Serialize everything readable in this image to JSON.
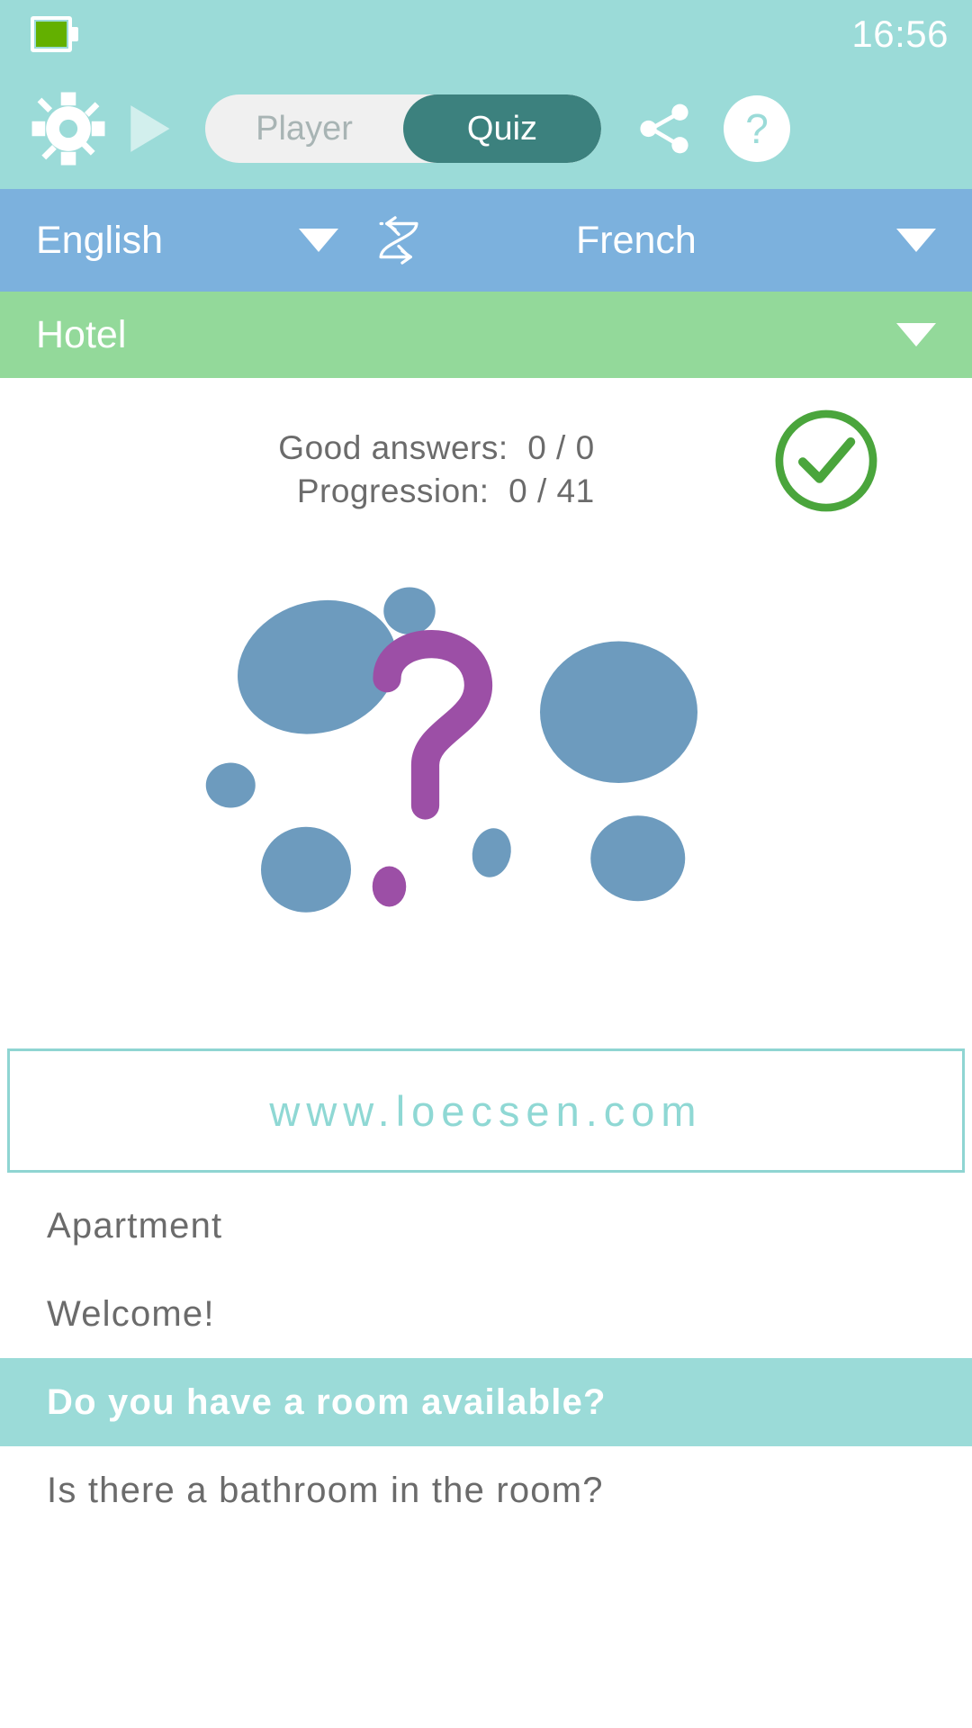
{
  "statusbar": {
    "battery_icon": "battery-icon",
    "time": "16:56"
  },
  "toolbar": {
    "settings_icon": "gear-icon",
    "play_icon": "play-icon",
    "mode_player": "Player",
    "mode_quiz": "Quiz",
    "share_icon": "share-icon",
    "help_label": "?"
  },
  "language_bar": {
    "source_language": "English",
    "target_language": "French",
    "swap_icon": "swap-arrows-icon",
    "dropdown_icon": "caret-down-icon"
  },
  "category_bar": {
    "category": "Hotel",
    "dropdown_icon": "caret-down-icon"
  },
  "score": {
    "good_answers_label": "Good answers:",
    "good_answers_value": "0 / 0",
    "progression_label": "Progression:",
    "progression_value": "0 / 41",
    "good_answers_line": "Good answers:  0 / 0",
    "progression_line": "Progression:  0 / 41",
    "status_icon": "check-circle-icon"
  },
  "illustration": {
    "name": "question-mark-blobs-illustration"
  },
  "banner": {
    "url": "www.loecsen.com"
  },
  "phrases": [
    {
      "text": "Apartment",
      "selected": false
    },
    {
      "text": "Welcome!",
      "selected": false
    },
    {
      "text": "Do you have a room available?",
      "selected": true
    },
    {
      "text": "Is there a bathroom in the room?",
      "selected": false
    }
  ],
  "colors": {
    "teal": "#9bdbd8",
    "teal_dark": "#3c817e",
    "blue": "#7cb1dd",
    "green": "#93d99a",
    "check_green": "#4aa53c",
    "blob_blue": "#6d9bbe",
    "question_purple": "#9c4fa6",
    "text_gray": "#6b6b6b",
    "banner_teal": "#8fd8d4"
  }
}
